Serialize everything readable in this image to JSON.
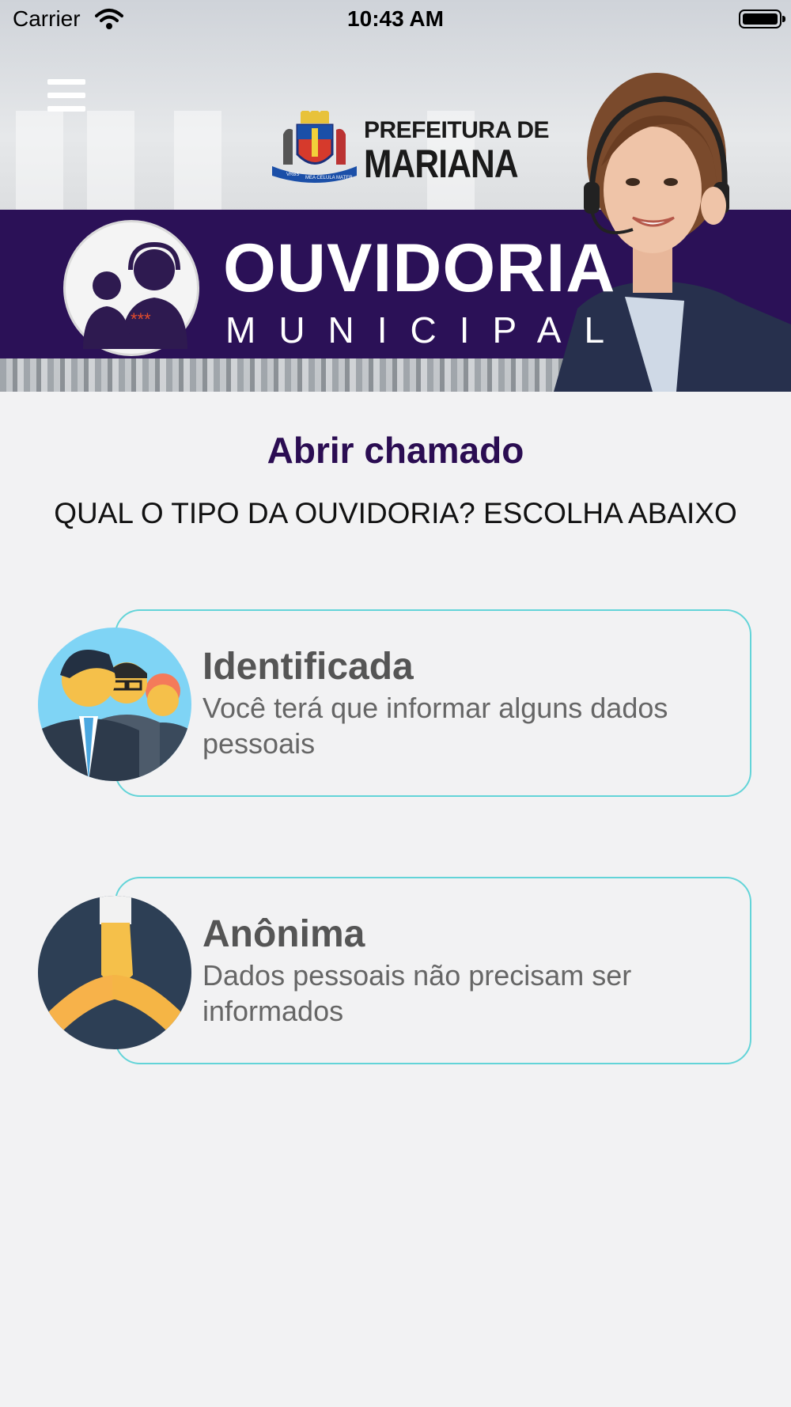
{
  "status_bar": {
    "carrier": "Carrier",
    "time": "10:43 AM"
  },
  "banner": {
    "logo_line1": "PREFEITURA DE",
    "logo_line2": "MARIANA",
    "crest_motto_left": "VRBS",
    "crest_motto_right": "MEA CELULA MATER",
    "title": "OUVIDORIA",
    "subtitle": "MUNICIPAL"
  },
  "main": {
    "title": "Abrir chamado",
    "subtitle": "QUAL O TIPO DA OUVIDORIA? ESCOLHA ABAIXO",
    "options": [
      {
        "title": "Identificada",
        "description": "Você terá que informar alguns dados pessoais"
      },
      {
        "title": "Anônima",
        "description": "Dados pessoais não precisam ser informados"
      }
    ]
  },
  "colors": {
    "primary": "#2b0d52",
    "accent_border": "#63d4d8",
    "background": "#f2f2f3"
  }
}
